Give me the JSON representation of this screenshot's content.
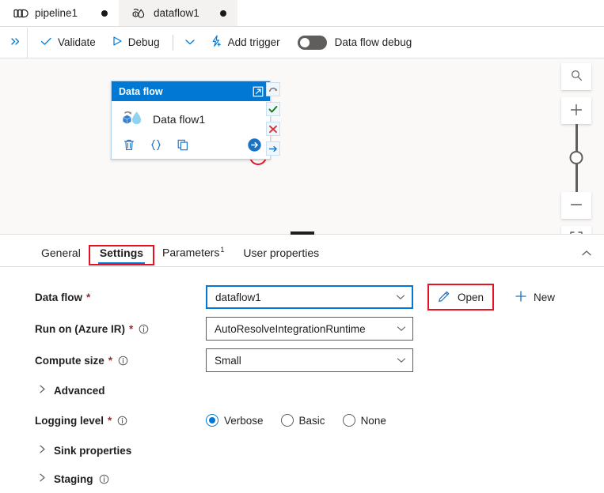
{
  "tabs": [
    {
      "label": "pipeline1",
      "icon": "pipeline-icon",
      "active": false,
      "dirty": true
    },
    {
      "label": "dataflow1",
      "icon": "dataflow-icon",
      "active": true,
      "dirty": true
    }
  ],
  "toolbar": {
    "expand_icon": "double-chevron-right-icon",
    "validate_label": "Validate",
    "debug_label": "Debug",
    "debug_caret_icon": "chevron-down-icon",
    "add_trigger_label": "Add trigger",
    "data_flow_debug_label": "Data flow debug",
    "data_flow_debug_on": false
  },
  "canvas": {
    "node": {
      "header_title": "Data flow",
      "open_new_window_icon": "open-in-new-window-icon",
      "name": "Data flow1",
      "type_icon": "data-flow-activity-icon",
      "footer_icons": [
        "delete-icon",
        "code-icon",
        "clone-icon",
        "run-arrow-icon"
      ]
    },
    "connectors": [
      {
        "name": "on-skip-icon",
        "color": "#797775"
      },
      {
        "name": "on-success-icon",
        "color": "#107c10"
      },
      {
        "name": "on-failure-icon",
        "color": "#d13438"
      },
      {
        "name": "on-completion-icon",
        "color": "#0078d4"
      }
    ],
    "annotation_circle_color": "#e81123",
    "zoom_controls": {
      "search_icon": "search-icon",
      "zoom_in_icon": "plus-icon",
      "zoom_out_icon": "minus-icon",
      "fit_icon": "fit-to-screen-icon"
    }
  },
  "panel": {
    "tabs": [
      {
        "label": "General",
        "active": false,
        "badge": ""
      },
      {
        "label": "Settings",
        "active": true,
        "badge": "",
        "highlighted": true
      },
      {
        "label": "Parameters",
        "active": false,
        "badge": "1"
      },
      {
        "label": "User properties",
        "active": false,
        "badge": ""
      }
    ],
    "collapse_icon": "chevron-up-icon",
    "highlight_color": "#e81123",
    "accent_color": "#0078d4",
    "fields": {
      "data_flow": {
        "label": "Data flow",
        "required": "*",
        "value": "dataflow1",
        "open_label": "Open",
        "open_icon": "pencil-icon",
        "new_label": "New",
        "new_icon": "plus-icon"
      },
      "run_on": {
        "label": "Run on (Azure IR)",
        "required": "*",
        "info_icon": "info-icon",
        "value": "AutoResolveIntegrationRuntime"
      },
      "compute_size": {
        "label": "Compute size",
        "required": "*",
        "info_icon": "info-icon",
        "value": "Small"
      },
      "advanced": {
        "label": "Advanced",
        "chevron_icon": "chevron-right-icon"
      },
      "logging_level": {
        "label": "Logging level",
        "required": "*",
        "info_icon": "info-icon",
        "options": [
          "Verbose",
          "Basic",
          "None"
        ],
        "selected": "Verbose"
      },
      "sink_properties": {
        "label": "Sink properties",
        "chevron_icon": "chevron-right-icon"
      },
      "staging": {
        "label": "Staging",
        "chevron_icon": "chevron-right-icon",
        "info_icon": "info-icon"
      }
    }
  }
}
